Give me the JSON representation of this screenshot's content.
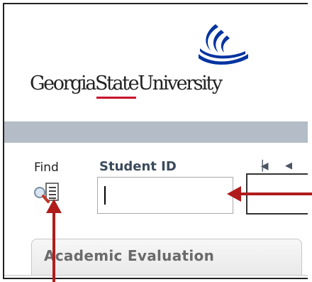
{
  "logo": {
    "text_before": "Georgia",
    "text_state": "State",
    "text_after": "University",
    "brand_blue": "#0033a0",
    "brand_red": "#c8102e",
    "icon": "gsu-flame-icon"
  },
  "search": {
    "find_label": "Find",
    "find_icon": "magnifier-list-icon",
    "student_id_label": "Student ID",
    "student_id_value": "",
    "nav_first_icon": "first-page-icon",
    "nav_prev_icon": "previous-page-icon"
  },
  "tabs": [
    {
      "label": "Academic Evaluation"
    }
  ],
  "annotations": {
    "arrow_color": "#b01c1c",
    "arrow_input": "red-arrow-left-icon",
    "arrow_find": "red-arrow-up-icon"
  },
  "colors": {
    "header_bar": "#b3bcc7",
    "label_text": "#3a4a5c",
    "tab_text": "#6a6a6a"
  }
}
